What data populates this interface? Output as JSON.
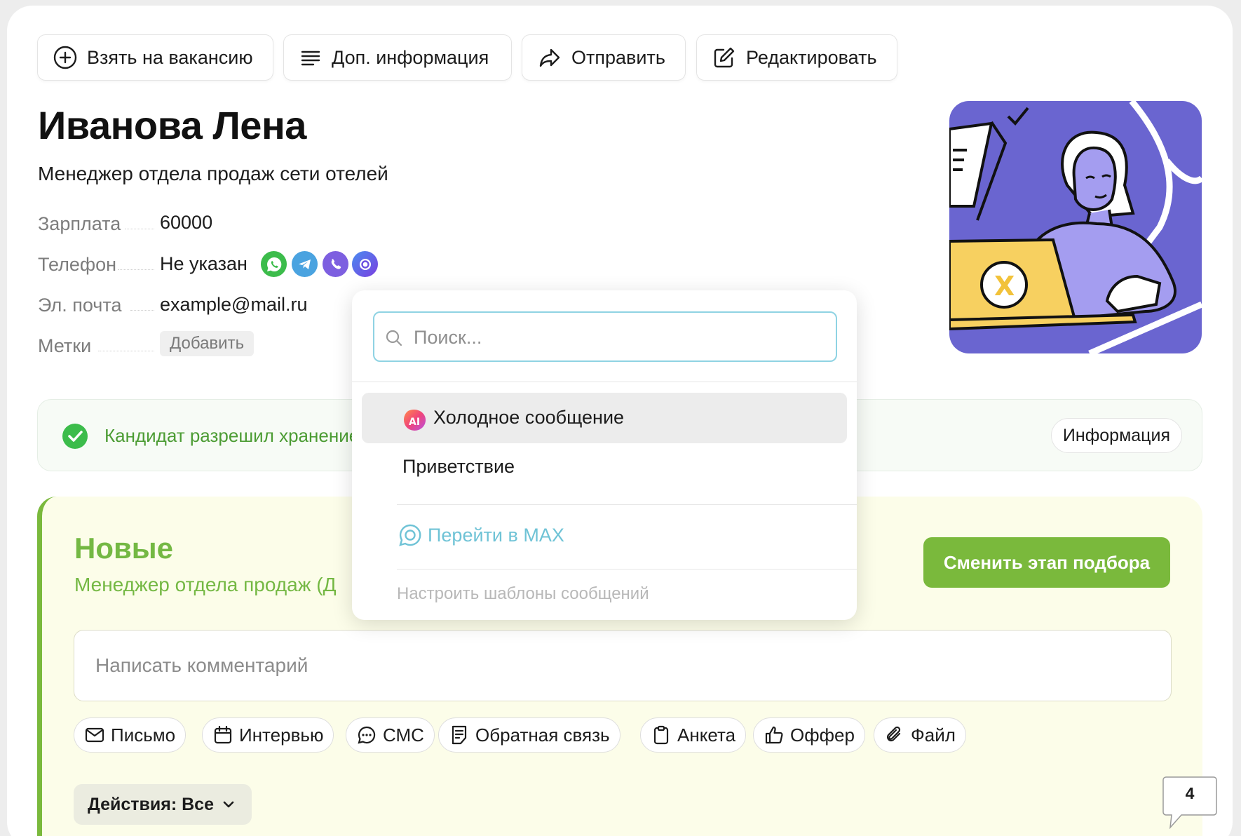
{
  "toolbar": {
    "take_vacancy": "Взять на вакансию",
    "more_info": "Доп. информация",
    "send": "Отправить",
    "edit": "Редактировать"
  },
  "candidate": {
    "name": "Иванова Лена",
    "position": "Менеджер отдела продаж сети отелей",
    "fields": {
      "salary_label": "Зарплата",
      "salary_value": "60000",
      "phone_label": "Телефон",
      "phone_value": "Не указан",
      "email_label": "Эл. почта",
      "email_value": "example@mail.ru",
      "tags_label": "Метки",
      "tags_add": "Добавить"
    },
    "messengers": [
      "whatsapp-icon",
      "telegram-icon",
      "viber-icon",
      "max-messenger-icon"
    ]
  },
  "consent": {
    "text": "Кандидат разрешил хранение",
    "info_button": "Информация"
  },
  "stage": {
    "title": "Новые",
    "subtitle": "Менеджер отдела продаж (Д",
    "change_button": "Сменить этап подбора",
    "comment_placeholder": "Написать комментарий",
    "actions": [
      "Письмо",
      "Интервью",
      "СМС",
      "Обратная связь",
      "Анкета",
      "Оффер",
      "Файл"
    ],
    "filter_label": "Действия: Все"
  },
  "badge_count": "4",
  "dropdown": {
    "search_placeholder": "Поиск...",
    "items": [
      "Холодное сообщение",
      "Приветствие"
    ],
    "ai_badge": "AI",
    "max_link": "Перейти в MAX",
    "footer": "Настроить шаблоны сообщений"
  },
  "colors": {
    "accent_green": "#7ab93c",
    "stage_bg": "#fcfde9",
    "illustration_bg": "#6a65d0",
    "link_cyan": "#6fc3d6"
  }
}
